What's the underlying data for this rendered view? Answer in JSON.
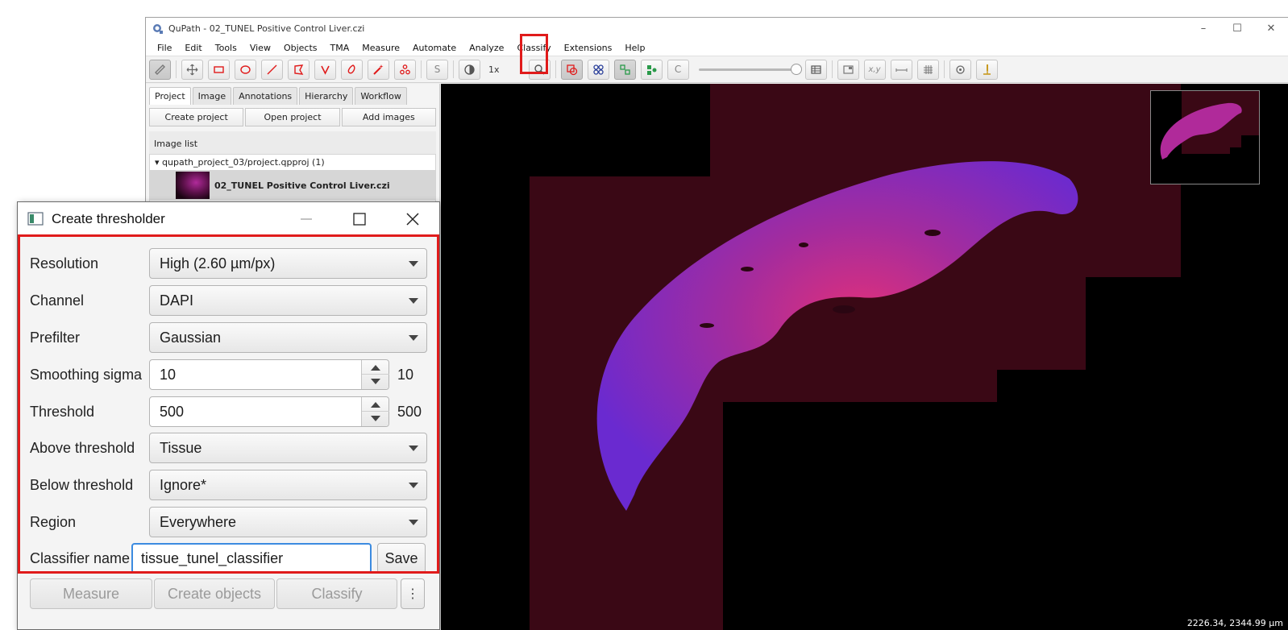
{
  "main_window": {
    "title": "QuPath - 02_TUNEL Positive Control Liver.czi",
    "controls": {
      "minimize": "–",
      "maximize": "☐",
      "close": "✕"
    }
  },
  "menu": [
    "File",
    "Edit",
    "Tools",
    "View",
    "Objects",
    "TMA",
    "Measure",
    "Automate",
    "Analyze",
    "Classify",
    "Extensions",
    "Help"
  ],
  "toolbar": {
    "zoom_label": "1x",
    "highlighted_button_text": "C",
    "s_button_text": "S",
    "xy_text": "x,y",
    "accent_red": "#e01b1b"
  },
  "left_panel": {
    "tabs": [
      "Project",
      "Image",
      "Annotations",
      "Hierarchy",
      "Workflow"
    ],
    "buttons": [
      "Create project",
      "Open project",
      "Add images"
    ],
    "image_list_label": "Image list",
    "project_root": "▾ qupath_project_03/project.qpproj (1)",
    "image_name": "02_TUNEL Positive Control Liver.czi"
  },
  "viewer": {
    "coordinates": "2226.34, 2344.99 µm"
  },
  "dialog": {
    "title": "Create thresholder",
    "controls": {
      "minimize": "—",
      "maximize": "☐",
      "close": "✕"
    },
    "labels": {
      "resolution": "Resolution",
      "channel": "Channel",
      "prefilter": "Prefilter",
      "smoothing": "Smoothing sigma",
      "threshold": "Threshold",
      "above": "Above threshold",
      "below": "Below threshold",
      "region": "Region",
      "classifier": "Classifier name"
    },
    "values": {
      "resolution": "High (2.60 µm/px)",
      "channel": "DAPI",
      "prefilter": "Gaussian",
      "smoothing": "10",
      "smoothing_display": "10",
      "threshold": "500",
      "threshold_display": "500",
      "above": "Tissue",
      "below": "Ignore*",
      "region": "Everywhere",
      "classifier": "tissue_tunel_classifier"
    },
    "save_label": "Save",
    "bottom_buttons": {
      "measure": "Measure",
      "create_objects": "Create objects",
      "classify": "Classify",
      "more": "⋮"
    }
  }
}
